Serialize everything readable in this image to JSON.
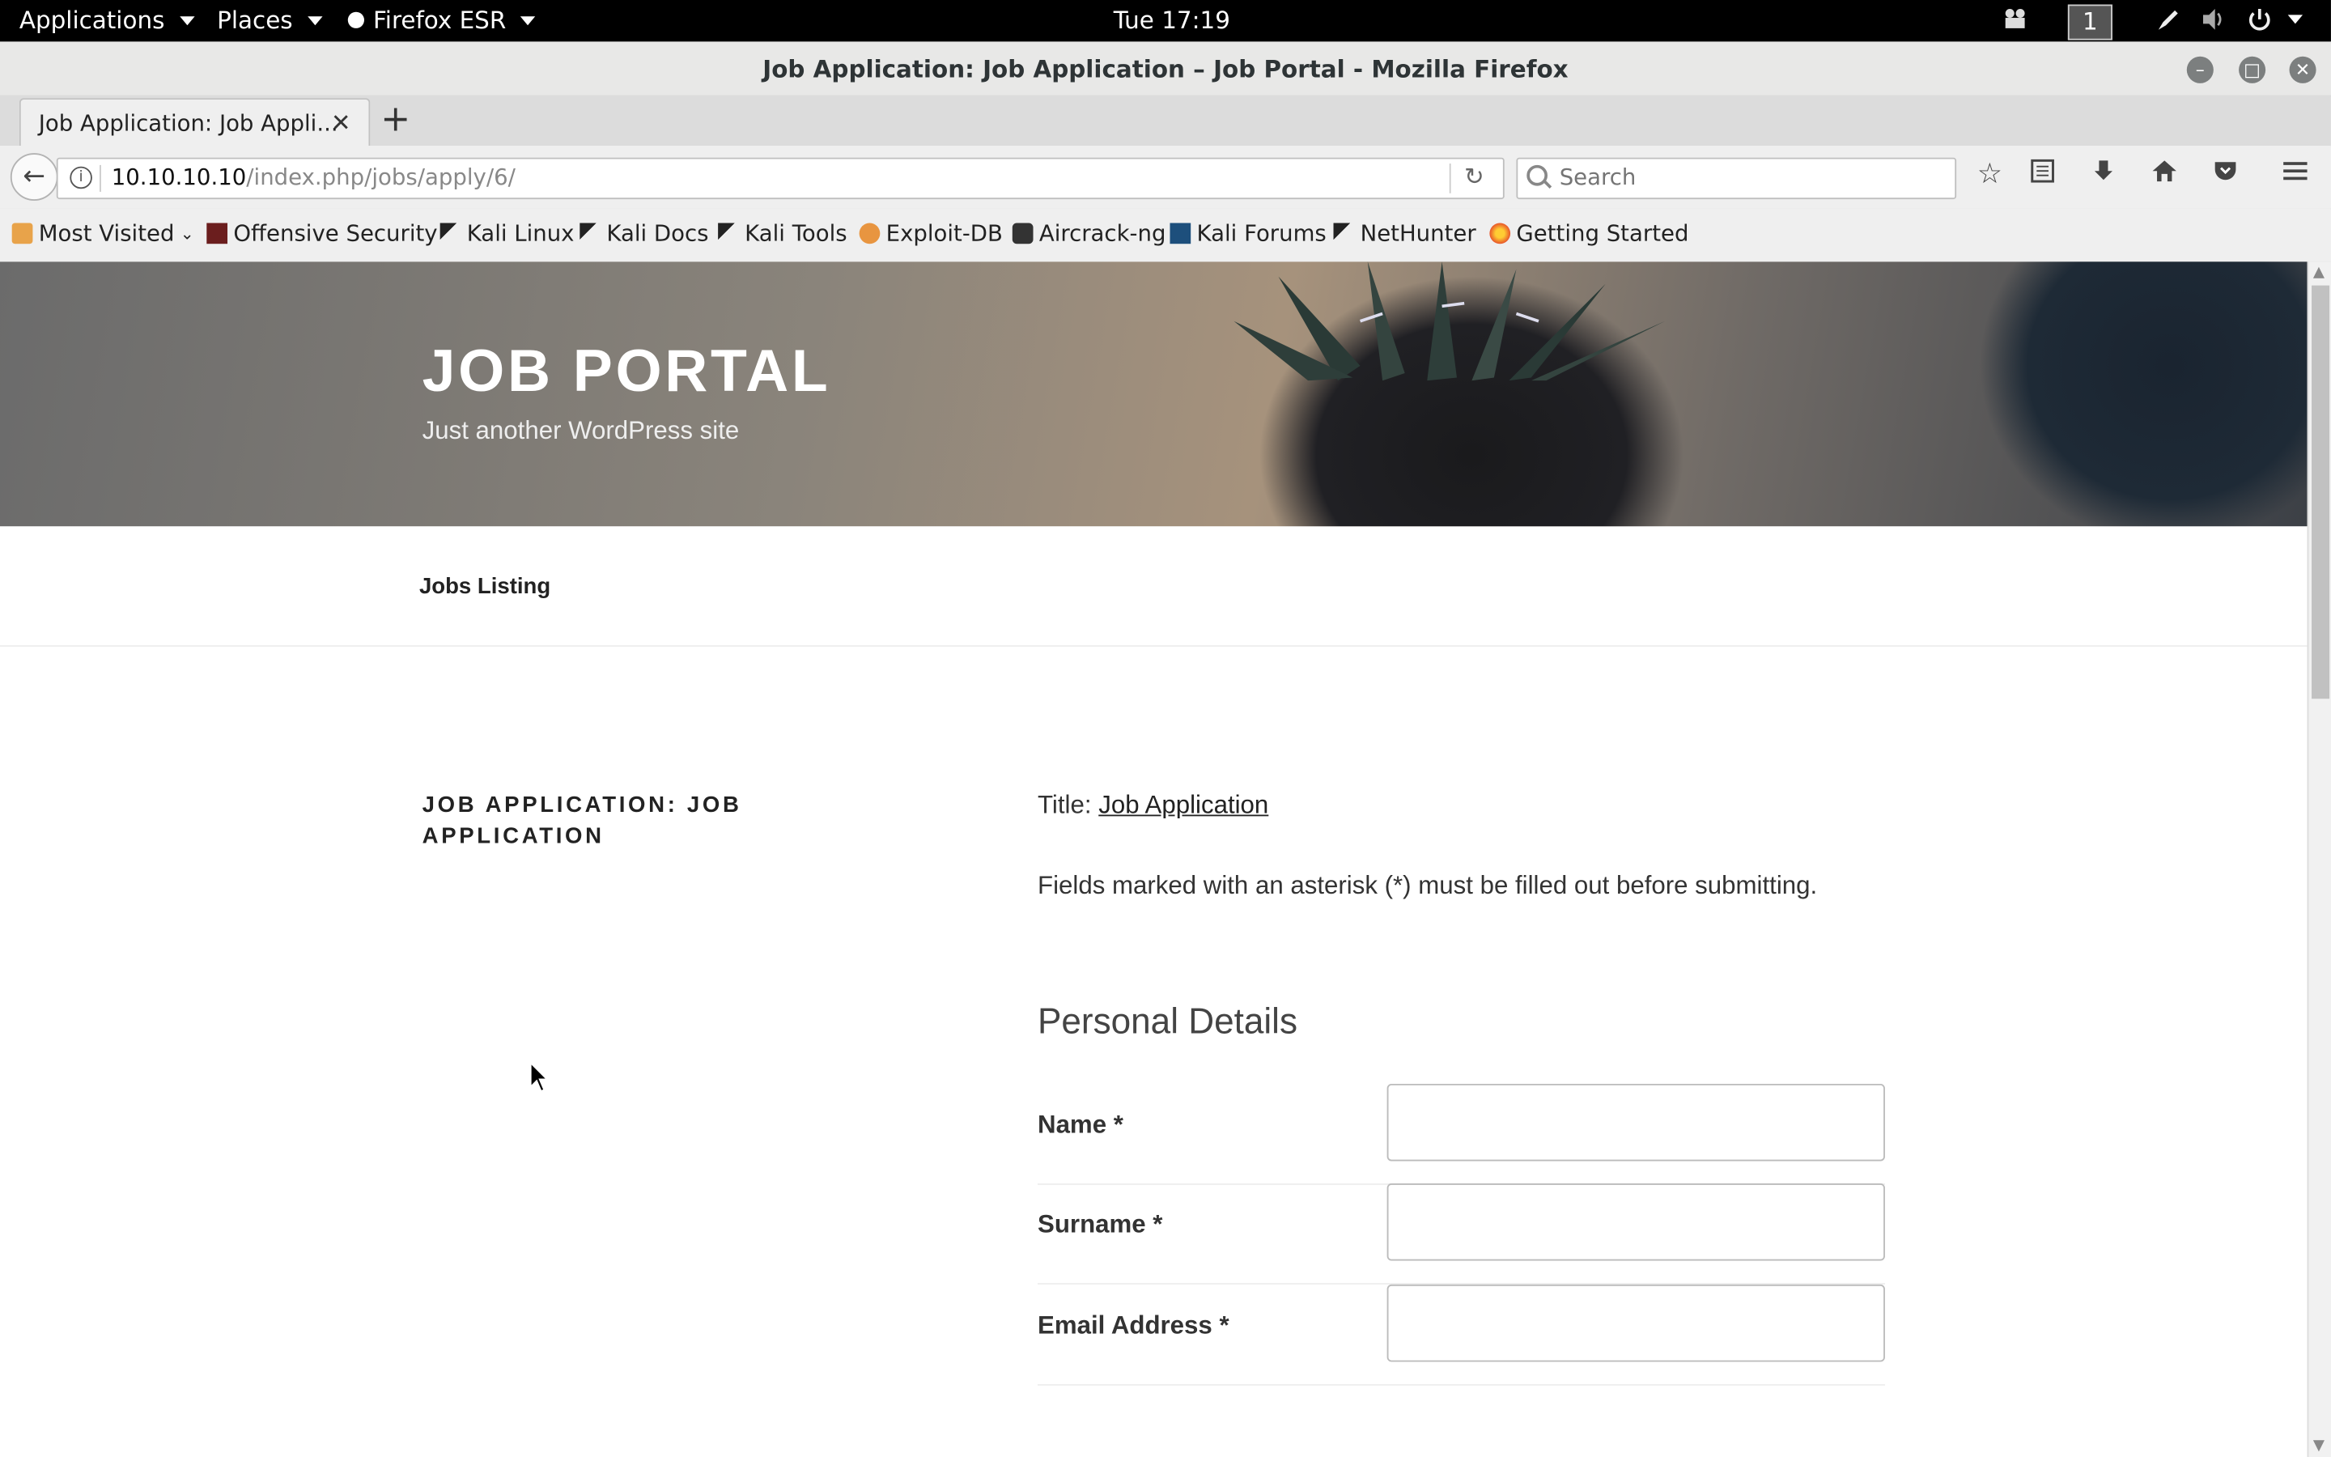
{
  "topbar": {
    "applications": "Applications",
    "places": "Places",
    "firefox": "Firefox ESR",
    "clock": "Tue 17:19",
    "workspace": "1"
  },
  "window": {
    "title": "Job Application: Job Application – Job Portal - Mozilla Firefox"
  },
  "tabs": [
    {
      "title": "Job Application: Job Appli..."
    }
  ],
  "navbar": {
    "url_host": "10.10.10.10",
    "url_path": "/index.php/jobs/apply/6/",
    "search_placeholder": "Search"
  },
  "bookmarks": [
    {
      "label": "Most Visited",
      "icon": "folder-icon"
    },
    {
      "label": "Offensive Security",
      "icon": "offsec-icon"
    },
    {
      "label": "Kali Linux",
      "icon": "kali-icon"
    },
    {
      "label": "Kali Docs",
      "icon": "kali-icon"
    },
    {
      "label": "Kali Tools",
      "icon": "kali-icon"
    },
    {
      "label": "Exploit-DB",
      "icon": "exploitdb-icon"
    },
    {
      "label": "Aircrack-ng",
      "icon": "aircrack-icon"
    },
    {
      "label": "Kali Forums",
      "icon": "kali-forums-icon"
    },
    {
      "label": "NetHunter",
      "icon": "kali-icon"
    },
    {
      "label": "Getting Started",
      "icon": "firefox-icon"
    }
  ],
  "site": {
    "title": "JOB PORTAL",
    "description": "Just another WordPress site",
    "menu": [
      "Jobs Listing"
    ]
  },
  "page": {
    "heading": "JOB APPLICATION: JOB APPLICATION",
    "title_prefix": "Title:",
    "title_link": "Job Application",
    "notice": "Fields marked with an asterisk (*) must be filled out before submitting.",
    "section": "Personal Details",
    "fields": [
      {
        "label": "Name *",
        "value": ""
      },
      {
        "label": "Surname *",
        "value": ""
      },
      {
        "label": "Email Address *",
        "value": ""
      }
    ]
  }
}
